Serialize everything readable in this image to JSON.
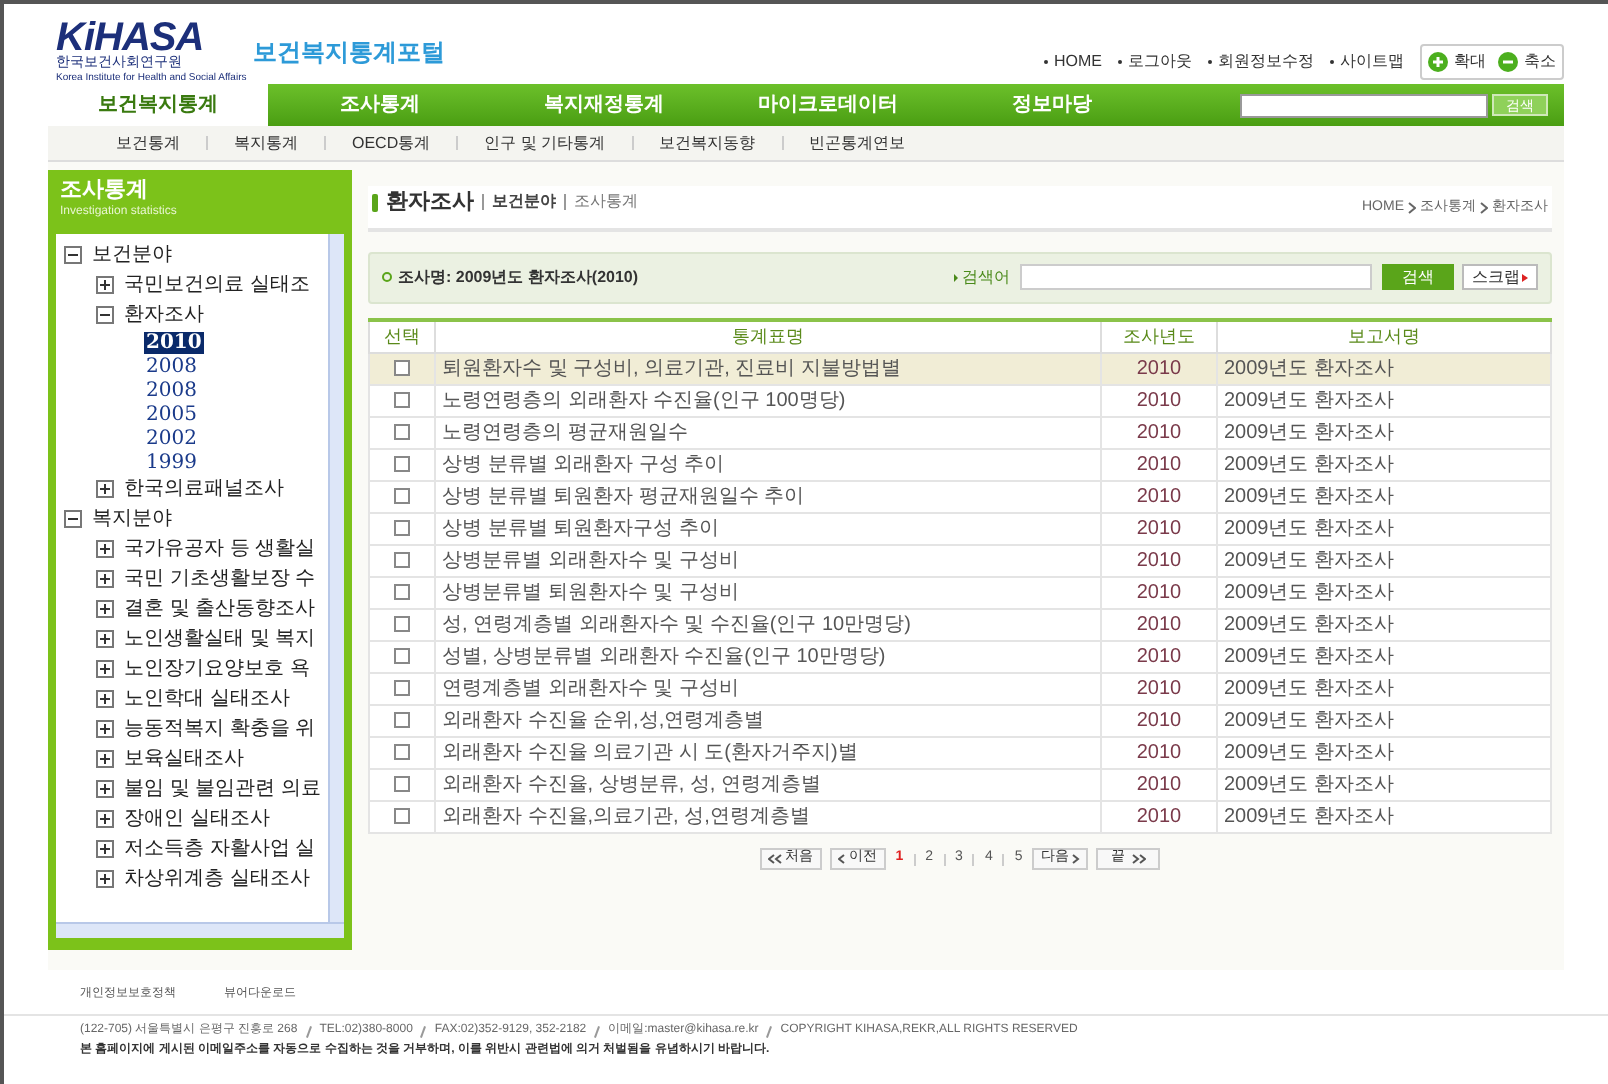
{
  "header": {
    "logo_text": "KiHASA",
    "logo_subtitle": "한국보건사회연구원",
    "logo_tagline": "Korea Institute for Health and Social Affairs",
    "portal_title": "보건복지통계포털",
    "top_links": [
      "HOME",
      "로그아웃",
      "회원정보수정",
      "사이트맵"
    ],
    "zoom_buttons": [
      {
        "label": "확대",
        "kind": "plus"
      },
      {
        "label": "축소",
        "kind": "minus"
      }
    ]
  },
  "main_nav": [
    {
      "label": "보건복지통계",
      "selected": true
    },
    {
      "label": "조사통계",
      "selected": false
    },
    {
      "label": "복지재정통계",
      "selected": false
    },
    {
      "label": "마이크로데이터",
      "selected": false
    },
    {
      "label": "정보마당",
      "selected": false
    }
  ],
  "nav_search": {
    "button": "검색"
  },
  "sub_nav": [
    "보건통계",
    "복지통계",
    "OECD통계",
    "인구 및 기타통계",
    "보건복지동향",
    "빈곤통계연보"
  ],
  "sidebar": {
    "title": "조사통계",
    "subtitle": "Investigation statistics",
    "tree": [
      {
        "label": "보건분야",
        "expanded": true,
        "children": [
          {
            "label": "국민보건의료 실태조",
            "expanded": false
          },
          {
            "label": "환자조사",
            "expanded": true,
            "children": [
              {
                "label": "2010",
                "selected": true
              },
              {
                "label": "2008",
                "selected": false
              },
              {
                "label": "2008",
                "selected": false
              },
              {
                "label": "2005",
                "selected": false
              },
              {
                "label": "2002",
                "selected": false
              },
              {
                "label": "1999",
                "selected": false
              }
            ]
          },
          {
            "label": "한국의료패널조사",
            "expanded": false
          }
        ]
      },
      {
        "label": "복지분야",
        "expanded": true,
        "children": [
          {
            "label": "국가유공자 등 생활실",
            "expanded": false
          },
          {
            "label": "국민 기초생활보장 수",
            "expanded": false
          },
          {
            "label": "결혼 및 출산동향조사",
            "expanded": false
          },
          {
            "label": "노인생활실태 및 복지",
            "expanded": false
          },
          {
            "label": "노인장기요양보호 욕",
            "expanded": false
          },
          {
            "label": "노인학대 실태조사",
            "expanded": false
          },
          {
            "label": "능동적복지 확충을 위",
            "expanded": false
          },
          {
            "label": "보육실태조사",
            "expanded": false
          },
          {
            "label": "불임 및 불임관련 의료",
            "expanded": false
          },
          {
            "label": "장애인 실태조사",
            "expanded": false
          },
          {
            "label": "저소득층 자활사업 실",
            "expanded": false
          },
          {
            "label": "차상위계층 실태조사",
            "expanded": false
          }
        ]
      }
    ]
  },
  "page_heading": {
    "title": "환자조사",
    "crumbs": [
      "보건분야",
      "조사통계"
    ],
    "breadcrumb": [
      "HOME",
      "조사통계",
      "환자조사"
    ]
  },
  "survey_bar": {
    "label": "조사명: 2009년도 환자조사(2010)",
    "search_label": "검색어",
    "search_button": "검색",
    "scrap_button": "스크랩"
  },
  "table": {
    "columns": [
      "선택",
      "통계표명",
      "조사년도",
      "보고서명"
    ],
    "rows": [
      {
        "checked": false,
        "selected": true,
        "name": "퇴원환자수 및 구성비, 의료기관, 진료비 지불방법별",
        "year": "2010",
        "report": "2009년도 환자조사"
      },
      {
        "checked": false,
        "selected": false,
        "name": "노령연령층의 외래환자 수진율(인구 100명당)",
        "year": "2010",
        "report": "2009년도 환자조사"
      },
      {
        "checked": false,
        "selected": false,
        "name": "노령연령층의 평균재원일수",
        "year": "2010",
        "report": "2009년도 환자조사"
      },
      {
        "checked": false,
        "selected": false,
        "name": "상병 분류별 외래환자 구성 추이",
        "year": "2010",
        "report": "2009년도 환자조사"
      },
      {
        "checked": false,
        "selected": false,
        "name": "상병 분류별 퇴원환자 평균재원일수 추이",
        "year": "2010",
        "report": "2009년도 환자조사"
      },
      {
        "checked": false,
        "selected": false,
        "name": "상병 분류별 퇴원환자구성 추이",
        "year": "2010",
        "report": "2009년도 환자조사"
      },
      {
        "checked": false,
        "selected": false,
        "name": "상병분류별 외래환자수 및 구성비",
        "year": "2010",
        "report": "2009년도 환자조사"
      },
      {
        "checked": false,
        "selected": false,
        "name": "상병분류별 퇴원환자수 및 구성비",
        "year": "2010",
        "report": "2009년도 환자조사"
      },
      {
        "checked": false,
        "selected": false,
        "name": "성, 연령계층별 외래환자수 및 수진율(인구 10만명당)",
        "year": "2010",
        "report": "2009년도 환자조사"
      },
      {
        "checked": false,
        "selected": false,
        "name": "성별, 상병분류별 외래환자 수진율(인구 10만명당)",
        "year": "2010",
        "report": "2009년도 환자조사"
      },
      {
        "checked": false,
        "selected": false,
        "name": "연령계층별 외래환자수 및 구성비",
        "year": "2010",
        "report": "2009년도 환자조사"
      },
      {
        "checked": false,
        "selected": false,
        "name": "외래환자 수진율 순위,성,연령계층별",
        "year": "2010",
        "report": "2009년도 환자조사"
      },
      {
        "checked": false,
        "selected": false,
        "name": "외래환자 수진율 의료기관 시 도(환자거주지)별",
        "year": "2010",
        "report": "2009년도 환자조사"
      },
      {
        "checked": false,
        "selected": false,
        "name": "외래환자 수진율, 상병분류, 성, 연령계층별",
        "year": "2010",
        "report": "2009년도 환자조사"
      },
      {
        "checked": false,
        "selected": false,
        "name": "외래환자 수진율,의료기관, 성,연령계층별",
        "year": "2010",
        "report": "2009년도 환자조사"
      }
    ]
  },
  "pagination": {
    "first": "처음",
    "prev": "이전",
    "pages": [
      {
        "label": "1",
        "selected": true
      },
      {
        "label": "2",
        "selected": false
      },
      {
        "label": "3",
        "selected": false
      },
      {
        "label": "4",
        "selected": false
      },
      {
        "label": "5",
        "selected": false
      }
    ],
    "next": "다음",
    "last": "끝"
  },
  "footer": {
    "links": [
      "개인정보보호정책",
      "뷰어다운로드"
    ],
    "address": [
      "(122-705) 서울특별시 은평구 진흥로 268",
      "TEL:02)380-8000",
      "FAX:02)352-9129, 352-2182",
      "이메일:master@kihasa.re.kr",
      "COPYRIGHT KIHASA,REKR,ALL RIGHTS RESERVED"
    ],
    "notice": "본 홈페이지에 게시된 이메일주소를 자동으로 수집하는 것을 거부하며, 이를 위반시 관련법에 의거 처벌됨을 유념하시기 바랍니다."
  }
}
